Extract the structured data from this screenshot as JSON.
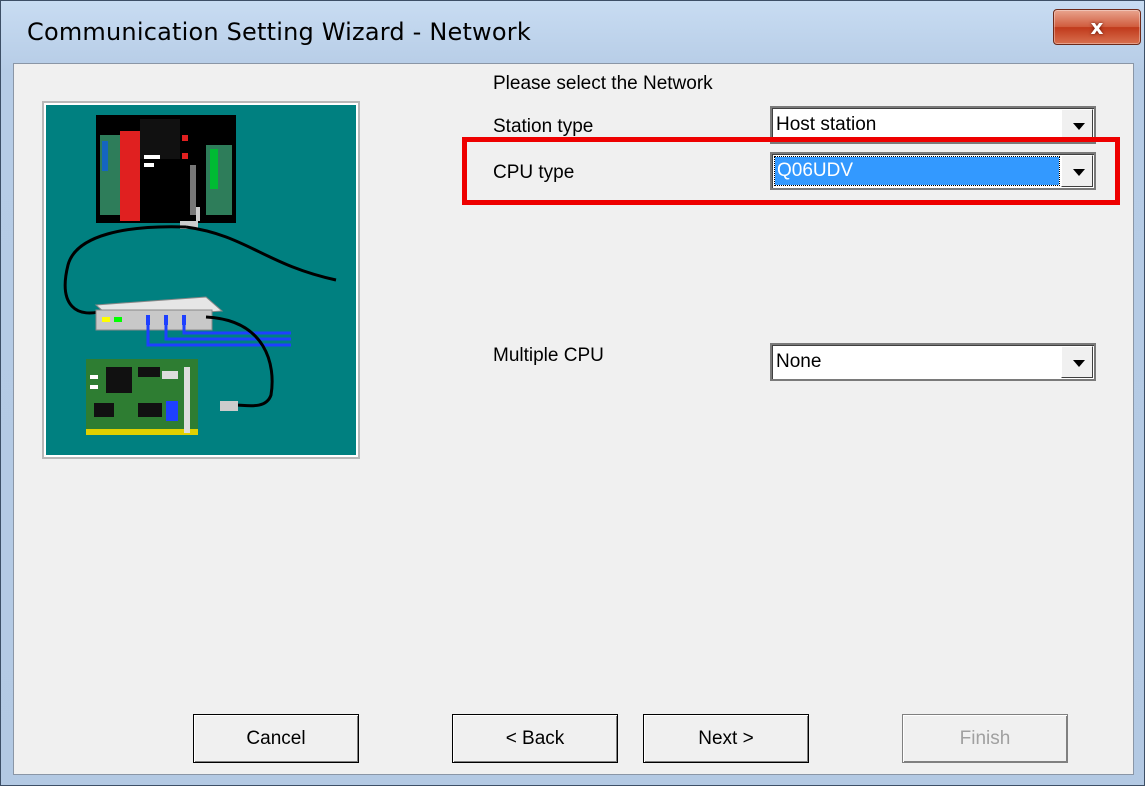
{
  "window": {
    "title": "Communication Setting Wizard - Network",
    "close_label": "x"
  },
  "form": {
    "heading": "Please select the Network",
    "station_type": {
      "label": "Station type",
      "value": "Host station"
    },
    "cpu_type": {
      "label": "CPU type",
      "value": "Q06UDV"
    },
    "multiple_cpu": {
      "label": "Multiple CPU",
      "value": "None"
    }
  },
  "buttons": {
    "cancel": "Cancel",
    "back": "< Back",
    "next": "Next >",
    "finish": "Finish"
  },
  "colors": {
    "illustration_bg": "#008080",
    "highlight": "#ee0000",
    "selection": "#3399ff"
  }
}
